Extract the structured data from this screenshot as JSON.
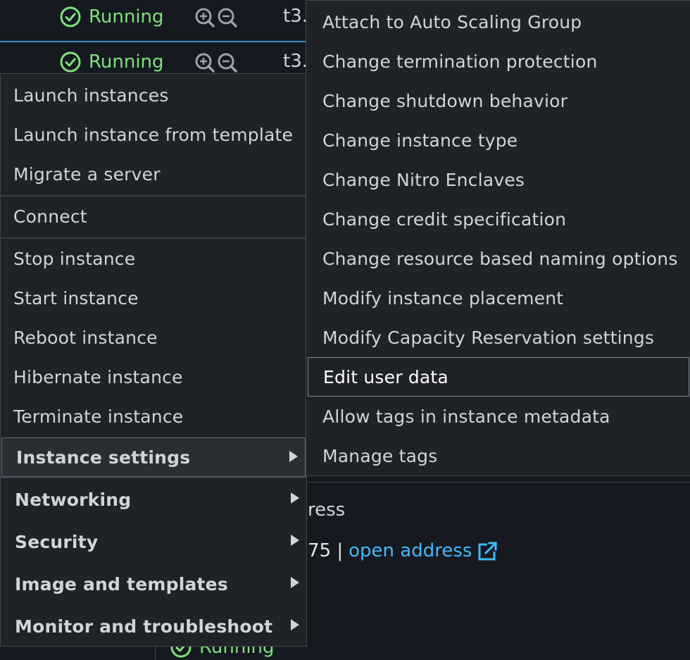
{
  "table_rows": [
    {
      "status": "Running",
      "type_text": "t3."
    },
    {
      "status": "Running",
      "type_text": "t3."
    }
  ],
  "detail": {
    "label_fragment": "ress",
    "value_fragment": "75 |",
    "open_address_link": "open address",
    "bottom_status": "Running"
  },
  "menu": {
    "items": [
      {
        "label": "Launch instances"
      },
      {
        "label": "Launch instance from template"
      },
      {
        "label": "Migrate a server"
      },
      {
        "label": "Connect"
      },
      {
        "label": "Stop instance"
      },
      {
        "label": "Start instance"
      },
      {
        "label": "Reboot instance"
      },
      {
        "label": "Hibernate instance"
      },
      {
        "label": "Terminate instance"
      },
      {
        "label": "Instance settings",
        "submenu": true,
        "active": true
      },
      {
        "label": "Networking",
        "submenu": true
      },
      {
        "label": "Security",
        "submenu": true
      },
      {
        "label": "Image and templates",
        "submenu": true
      },
      {
        "label": "Monitor and troubleshoot",
        "submenu": true
      }
    ]
  },
  "submenu": {
    "items": [
      {
        "label": "Attach to Auto Scaling Group"
      },
      {
        "label": "Change termination protection"
      },
      {
        "label": "Change shutdown behavior"
      },
      {
        "label": "Change instance type"
      },
      {
        "label": "Change Nitro Enclaves"
      },
      {
        "label": "Change credit specification"
      },
      {
        "label": "Change resource based naming options"
      },
      {
        "label": "Modify instance placement"
      },
      {
        "label": "Modify Capacity Reservation settings"
      },
      {
        "label": "Edit user data",
        "focused": true
      },
      {
        "label": "Allow tags in instance metadata"
      },
      {
        "label": "Manage tags"
      }
    ]
  },
  "colors": {
    "background": "#16191f",
    "menu_bg": "#1f2226",
    "running_green": "#7fe07a",
    "link_blue": "#44b9ff",
    "selection_border": "#3a8cc2"
  },
  "icons": [
    "check-circle-icon",
    "zoom-in-icon",
    "zoom-out-icon",
    "external-link-icon",
    "caret-right-icon"
  ]
}
